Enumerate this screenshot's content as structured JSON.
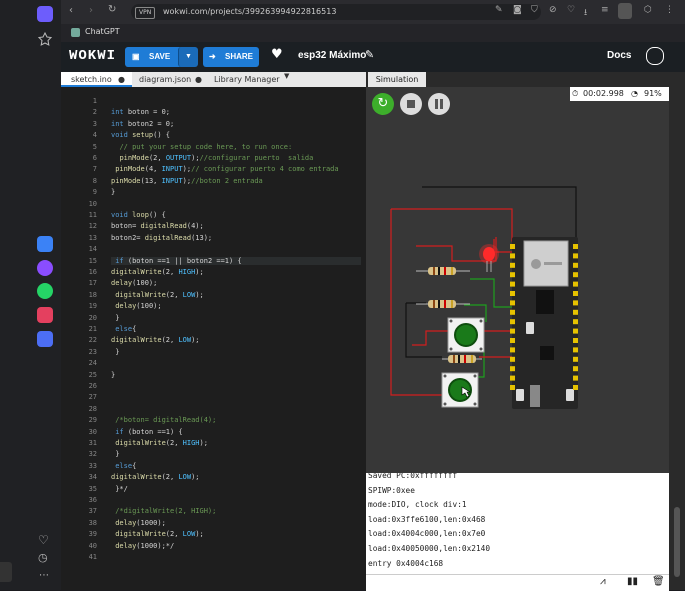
{
  "browser": {
    "url": "wokwi.com/projects/399263994922816513",
    "vpn_label": "VPN",
    "bookmark": "ChatGPT"
  },
  "header": {
    "logo": "WOKWI",
    "save_label": "SAVE",
    "share_label": "SHARE",
    "project_name": "esp32 Máximo",
    "docs_label": "Docs"
  },
  "tabs": {
    "sketch": "sketch.ino",
    "diagram": "diagram.json",
    "library": "Library Manager",
    "simulation": "Simulation"
  },
  "editor": {
    "line_numbers": [
      "1",
      "2",
      "3",
      "4",
      "5",
      "6",
      "7",
      "8",
      "9",
      "10",
      "11",
      "12",
      "13",
      "14",
      "15",
      "16",
      "17",
      "18",
      "19",
      "20",
      "21",
      "22",
      "23",
      "24",
      "25",
      "26",
      "27",
      "28",
      "29",
      "30",
      "31",
      "32",
      "33",
      "34",
      "35",
      "36",
      "37",
      "38",
      "39",
      "40",
      "41"
    ],
    "lines": [
      "",
      "int boton = 0;",
      "int boton2 = 0;",
      "void setup() {",
      "  // put your setup code here, to run once:",
      "  pinMode(2, OUTPUT);//configurar puerto  salida",
      " pinMode(4, INPUT);// configurar puerto 4 como entrada",
      "pinMode(13, INPUT);//boton 2 entrada",
      "}",
      "",
      "void loop() {",
      "boton= digitalRead(4);",
      "boton2= digitalRead(13);",
      "",
      " if (boton ==1 || boton2 ==1) {",
      "digitalWrite(2, HIGH);",
      "delay(100);",
      " digitalWrite(2, LOW);",
      " delay(100);",
      " }",
      " else{",
      "digitalWrite(2, LOW);",
      " }",
      "",
      "}",
      "",
      "",
      "",
      " /*boton= digitalRead(4);",
      " if (boton ==1) {",
      " digitalWrite(2, HIGH);",
      " }",
      " else{",
      "digitalWrite(2, LOW);",
      " }*/",
      "",
      " /*digitalWrite(2, HIGH);",
      " delay(1000);",
      " digitalWrite(2, LOW);",
      " delay(1000);*/",
      ""
    ]
  },
  "simulation": {
    "timer": "00:02.998",
    "cpu": "91%"
  },
  "serial": {
    "lines": [
      "Saved PC:0xffffffff",
      "SPIWP:0xee",
      "mode:DIO, clock div:1",
      "load:0x3ffe6100,len:0x468",
      "load:0x4004c000,len:0x7e0",
      "load:0x40050000,len:0x2140",
      "entry 0x4004c168"
    ]
  },
  "colors": {
    "accent": "#1f7cd6",
    "sim_play": "#3dae2b",
    "led_red": "#ff2a2a"
  }
}
